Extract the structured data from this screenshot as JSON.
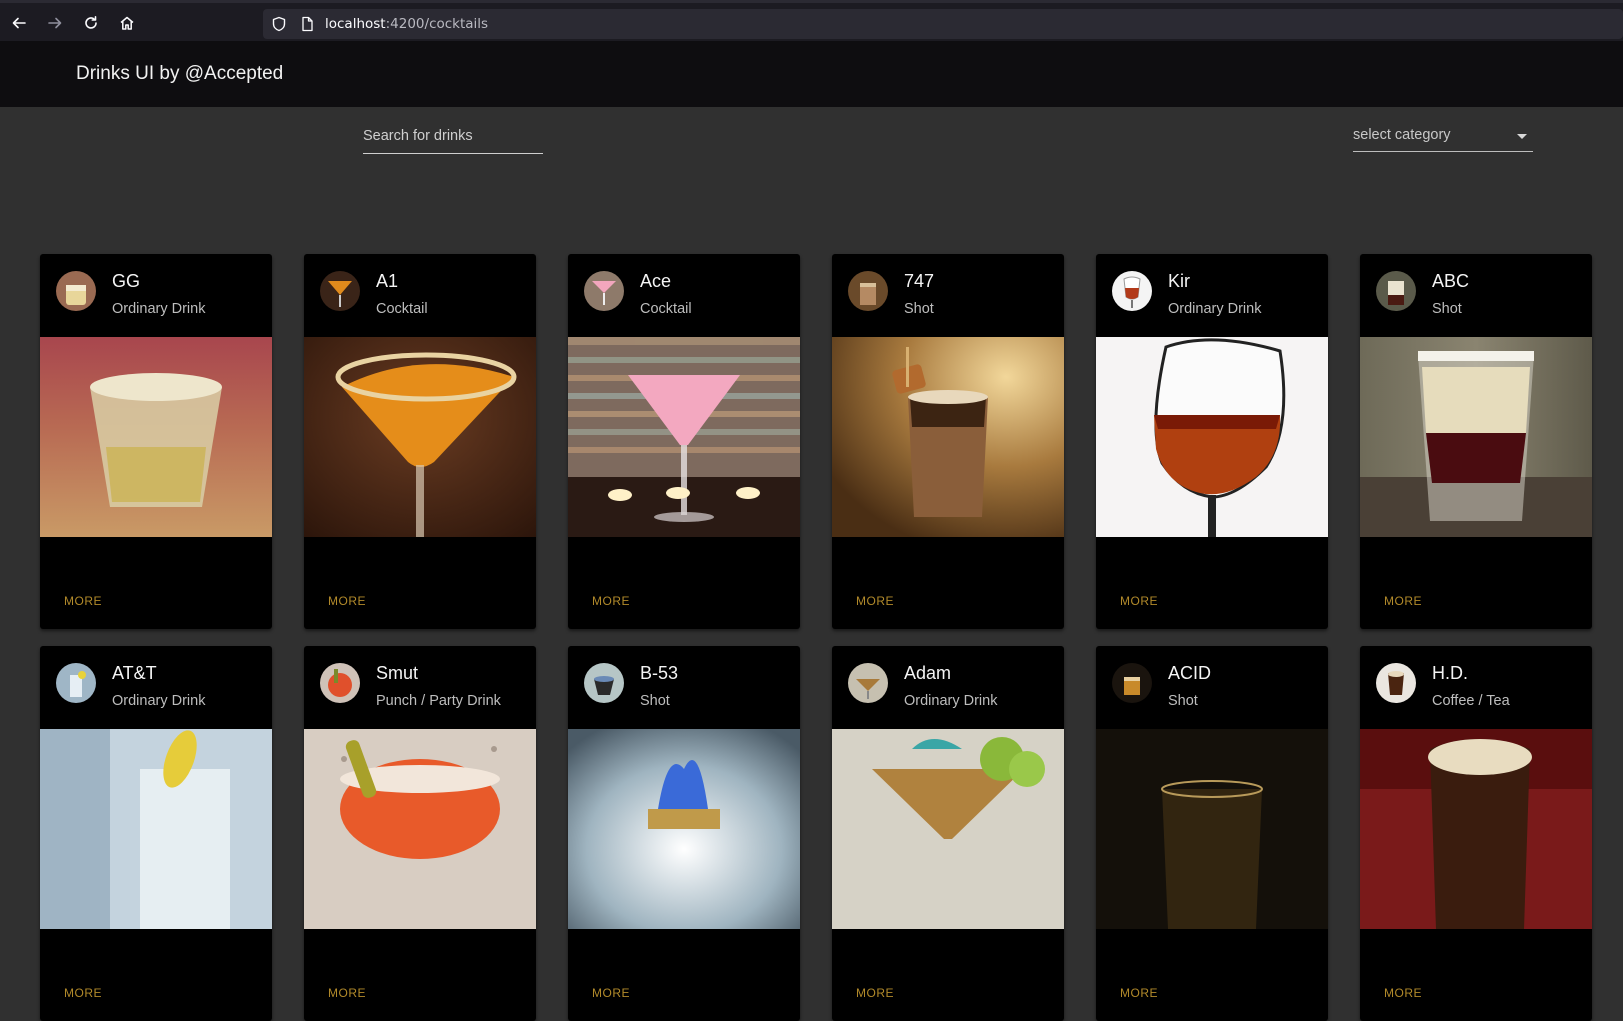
{
  "browser": {
    "url_host": "localhost",
    "url_path": ":4200/cocktails",
    "icons": [
      "back-arrow-icon",
      "forward-arrow-icon",
      "reload-icon",
      "home-icon",
      "shield-icon",
      "page-icon"
    ]
  },
  "header": {
    "title": "Drinks UI by @Accepted"
  },
  "filters": {
    "search_placeholder": "Search for drinks",
    "category_placeholder": "select category"
  },
  "more_label": "MORE",
  "accent_color": "#b28a2a",
  "drinks": [
    {
      "name": "GG",
      "category": "Ordinary Drink"
    },
    {
      "name": "A1",
      "category": "Cocktail"
    },
    {
      "name": "Ace",
      "category": "Cocktail"
    },
    {
      "name": "747",
      "category": "Shot"
    },
    {
      "name": "Kir",
      "category": "Ordinary Drink"
    },
    {
      "name": "ABC",
      "category": "Shot"
    },
    {
      "name": "AT&T",
      "category": "Ordinary Drink"
    },
    {
      "name": "Smut",
      "category": "Punch / Party Drink"
    },
    {
      "name": "B-53",
      "category": "Shot"
    },
    {
      "name": "Adam",
      "category": "Ordinary Drink"
    },
    {
      "name": "ACID",
      "category": "Shot"
    },
    {
      "name": "H.D.",
      "category": "Coffee / Tea"
    }
  ]
}
